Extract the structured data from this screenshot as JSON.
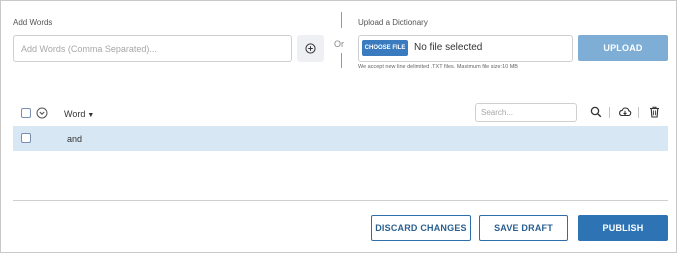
{
  "add_words": {
    "label": "Add Words",
    "placeholder": "Add Words (Comma Separated)...",
    "add_button_icon": "plus-circle-icon"
  },
  "divider": {
    "or_text": "Or"
  },
  "upload": {
    "label": "Upload a Dictionary",
    "choose_file_label": "CHOOSE FILE",
    "file_status": "No file selected",
    "upload_button_label": "UPLOAD",
    "hint": "We accept new line delimited .TXT files. Maximum file size:10 MB"
  },
  "table": {
    "column_header": "Word",
    "sort_caret": "▼",
    "search_placeholder": "Search...",
    "toolbar_icons": [
      "search-icon",
      "cloud-download-icon",
      "trash-icon"
    ],
    "rows": [
      {
        "word": "and",
        "checked": false
      }
    ]
  },
  "footer": {
    "discard_label": "DISCARD CHANGES",
    "save_draft_label": "SAVE DRAFT",
    "publish_label": "PUBLISH"
  },
  "colors": {
    "primary": "#2e74b5",
    "upload_disabled": "#7eadd6",
    "choose_file": "#3a7bbf",
    "row_highlight": "#d7e8f4"
  }
}
